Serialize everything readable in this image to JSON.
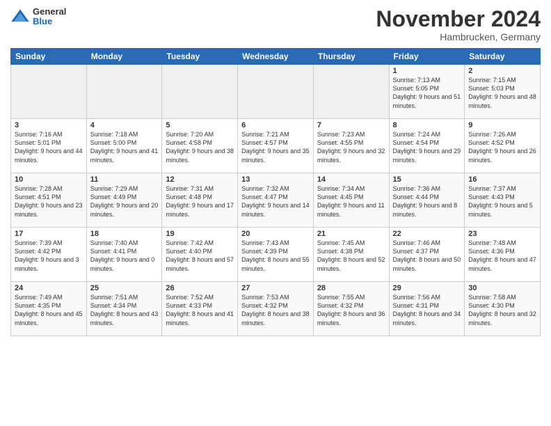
{
  "header": {
    "logo_general": "General",
    "logo_blue": "Blue",
    "month_title": "November 2024",
    "location": "Hambrucken, Germany"
  },
  "weekdays": [
    "Sunday",
    "Monday",
    "Tuesday",
    "Wednesday",
    "Thursday",
    "Friday",
    "Saturday"
  ],
  "weeks": [
    [
      {
        "day": "",
        "info": ""
      },
      {
        "day": "",
        "info": ""
      },
      {
        "day": "",
        "info": ""
      },
      {
        "day": "",
        "info": ""
      },
      {
        "day": "",
        "info": ""
      },
      {
        "day": "1",
        "info": "Sunrise: 7:13 AM\nSunset: 5:05 PM\nDaylight: 9 hours and 51 minutes."
      },
      {
        "day": "2",
        "info": "Sunrise: 7:15 AM\nSunset: 5:03 PM\nDaylight: 9 hours and 48 minutes."
      }
    ],
    [
      {
        "day": "3",
        "info": "Sunrise: 7:16 AM\nSunset: 5:01 PM\nDaylight: 9 hours and 44 minutes."
      },
      {
        "day": "4",
        "info": "Sunrise: 7:18 AM\nSunset: 5:00 PM\nDaylight: 9 hours and 41 minutes."
      },
      {
        "day": "5",
        "info": "Sunrise: 7:20 AM\nSunset: 4:58 PM\nDaylight: 9 hours and 38 minutes."
      },
      {
        "day": "6",
        "info": "Sunrise: 7:21 AM\nSunset: 4:57 PM\nDaylight: 9 hours and 35 minutes."
      },
      {
        "day": "7",
        "info": "Sunrise: 7:23 AM\nSunset: 4:55 PM\nDaylight: 9 hours and 32 minutes."
      },
      {
        "day": "8",
        "info": "Sunrise: 7:24 AM\nSunset: 4:54 PM\nDaylight: 9 hours and 29 minutes."
      },
      {
        "day": "9",
        "info": "Sunrise: 7:26 AM\nSunset: 4:52 PM\nDaylight: 9 hours and 26 minutes."
      }
    ],
    [
      {
        "day": "10",
        "info": "Sunrise: 7:28 AM\nSunset: 4:51 PM\nDaylight: 9 hours and 23 minutes."
      },
      {
        "day": "11",
        "info": "Sunrise: 7:29 AM\nSunset: 4:49 PM\nDaylight: 9 hours and 20 minutes."
      },
      {
        "day": "12",
        "info": "Sunrise: 7:31 AM\nSunset: 4:48 PM\nDaylight: 9 hours and 17 minutes."
      },
      {
        "day": "13",
        "info": "Sunrise: 7:32 AM\nSunset: 4:47 PM\nDaylight: 9 hours and 14 minutes."
      },
      {
        "day": "14",
        "info": "Sunrise: 7:34 AM\nSunset: 4:45 PM\nDaylight: 9 hours and 11 minutes."
      },
      {
        "day": "15",
        "info": "Sunrise: 7:36 AM\nSunset: 4:44 PM\nDaylight: 9 hours and 8 minutes."
      },
      {
        "day": "16",
        "info": "Sunrise: 7:37 AM\nSunset: 4:43 PM\nDaylight: 9 hours and 5 minutes."
      }
    ],
    [
      {
        "day": "17",
        "info": "Sunrise: 7:39 AM\nSunset: 4:42 PM\nDaylight: 9 hours and 3 minutes."
      },
      {
        "day": "18",
        "info": "Sunrise: 7:40 AM\nSunset: 4:41 PM\nDaylight: 9 hours and 0 minutes."
      },
      {
        "day": "19",
        "info": "Sunrise: 7:42 AM\nSunset: 4:40 PM\nDaylight: 8 hours and 57 minutes."
      },
      {
        "day": "20",
        "info": "Sunrise: 7:43 AM\nSunset: 4:39 PM\nDaylight: 8 hours and 55 minutes."
      },
      {
        "day": "21",
        "info": "Sunrise: 7:45 AM\nSunset: 4:38 PM\nDaylight: 8 hours and 52 minutes."
      },
      {
        "day": "22",
        "info": "Sunrise: 7:46 AM\nSunset: 4:37 PM\nDaylight: 8 hours and 50 minutes."
      },
      {
        "day": "23",
        "info": "Sunrise: 7:48 AM\nSunset: 4:36 PM\nDaylight: 8 hours and 47 minutes."
      }
    ],
    [
      {
        "day": "24",
        "info": "Sunrise: 7:49 AM\nSunset: 4:35 PM\nDaylight: 8 hours and 45 minutes."
      },
      {
        "day": "25",
        "info": "Sunrise: 7:51 AM\nSunset: 4:34 PM\nDaylight: 8 hours and 43 minutes."
      },
      {
        "day": "26",
        "info": "Sunrise: 7:52 AM\nSunset: 4:33 PM\nDaylight: 8 hours and 41 minutes."
      },
      {
        "day": "27",
        "info": "Sunrise: 7:53 AM\nSunset: 4:32 PM\nDaylight: 8 hours and 38 minutes."
      },
      {
        "day": "28",
        "info": "Sunrise: 7:55 AM\nSunset: 4:32 PM\nDaylight: 8 hours and 36 minutes."
      },
      {
        "day": "29",
        "info": "Sunrise: 7:56 AM\nSunset: 4:31 PM\nDaylight: 8 hours and 34 minutes."
      },
      {
        "day": "30",
        "info": "Sunrise: 7:58 AM\nSunset: 4:30 PM\nDaylight: 8 hours and 32 minutes."
      }
    ]
  ]
}
